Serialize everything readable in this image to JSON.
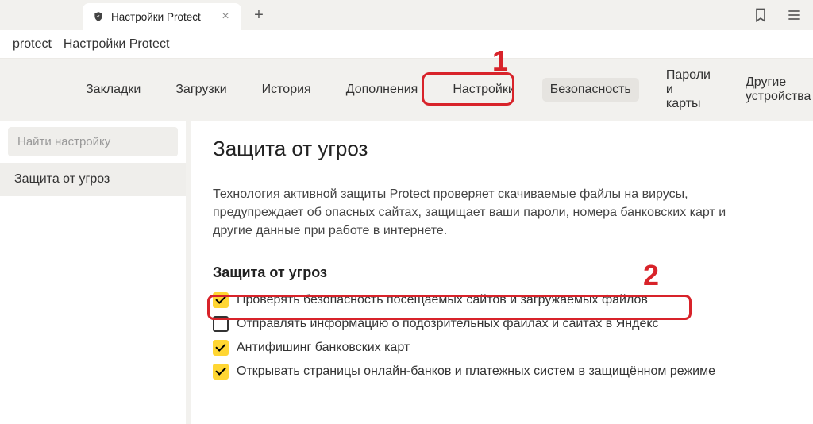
{
  "tab": {
    "title": "Настройки Protect"
  },
  "breadcrumb": {
    "seg1": "protect",
    "seg2": "Настройки Protect"
  },
  "nav": {
    "items": [
      {
        "label": "Закладки"
      },
      {
        "label": "Загрузки"
      },
      {
        "label": "История"
      },
      {
        "label": "Дополнения"
      },
      {
        "label": "Настройки"
      },
      {
        "label": "Безопасность"
      },
      {
        "label": "Пароли и карты"
      },
      {
        "label": "Другие устройства"
      }
    ]
  },
  "annotations": {
    "one": "1",
    "two": "2"
  },
  "sidebar": {
    "search_placeholder": "Найти настройку",
    "items": [
      {
        "label": "Защита от угроз"
      }
    ]
  },
  "content": {
    "title": "Защита от угроз",
    "description": "Технология активной защиты Protect проверяет скачиваемые файлы на вирусы, предупреждает об опасных сайтах, защищает ваши пароли, номера банковских карт и другие данные при работе в интернете.",
    "section_title": "Защита от угроз",
    "options": [
      {
        "label": "Проверять безопасность посещаемых сайтов и загружаемых файлов",
        "checked": true
      },
      {
        "label": "Отправлять информацию о подозрительных файлах и сайтах в Яндекс",
        "checked": false
      },
      {
        "label": "Антифишинг банковских карт",
        "checked": true
      },
      {
        "label": "Открывать страницы онлайн-банков и платежных систем в защищённом режиме",
        "checked": true
      }
    ]
  }
}
